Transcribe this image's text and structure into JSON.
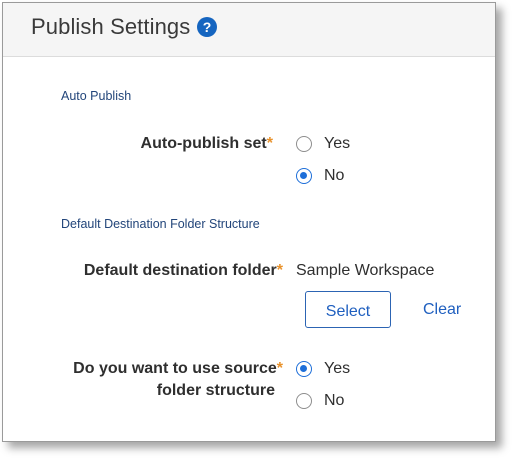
{
  "header": {
    "title": "Publish Settings",
    "help_icon": "question-circle-icon",
    "help_glyph": "?"
  },
  "sections": {
    "auto_publish": {
      "title": "Auto Publish",
      "field_label": "Auto-publish set",
      "required_mark": "*",
      "options": [
        {
          "label": "Yes",
          "selected": false
        },
        {
          "label": "No",
          "selected": true
        }
      ]
    },
    "destination": {
      "title": "Default Destination Folder Structure",
      "folder_label": "Default destination folder",
      "required_mark": "*",
      "folder_value": "Sample Workspace",
      "select_label": "Select",
      "clear_label": "Clear",
      "source_label_line1": "Do you want to use source",
      "source_label_line2": "folder structure",
      "source_options": [
        {
          "label": "Yes",
          "selected": true
        },
        {
          "label": "No",
          "selected": false
        }
      ]
    }
  },
  "colors": {
    "accent": "#1e6fd9",
    "required": "#e8912a",
    "section_title": "#22457a"
  }
}
